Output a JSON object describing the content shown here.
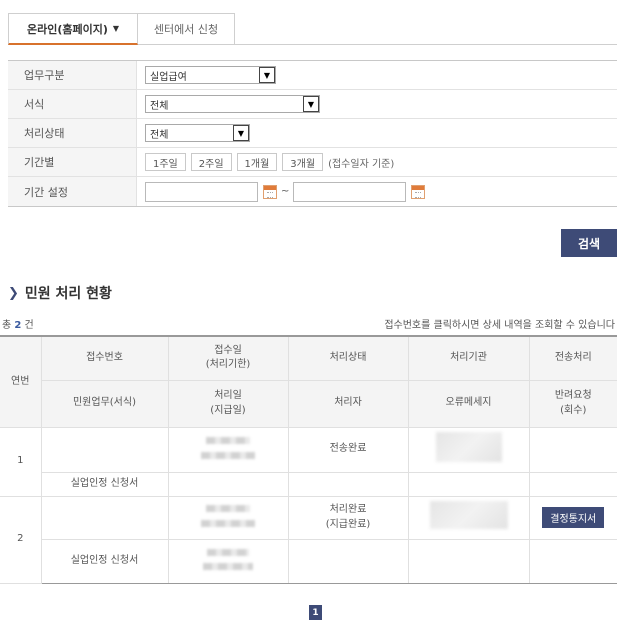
{
  "tabs": {
    "online_label": "온라인(홈페이지)",
    "center_label": "센터에서 신청"
  },
  "filters": {
    "work_type": {
      "label": "업무구분",
      "value": "실업급여"
    },
    "form": {
      "label": "서식",
      "value": "전체"
    },
    "status": {
      "label": "처리상태",
      "value": "전체"
    },
    "period": {
      "label": "기간별",
      "buttons": [
        "1주일",
        "2주일",
        "1개월",
        "3개월"
      ],
      "note": "(접수일자 기준)"
    },
    "date_range": {
      "label": "기간 설정",
      "separator": "~"
    }
  },
  "search_button": "검색",
  "section_title": "민원 처리 현황",
  "summary": {
    "count_prefix": "총",
    "count": "2",
    "count_suffix": "건",
    "hint": "접수번호를 클릭하시면 상세 내역을 조회할 수 있습니다"
  },
  "table": {
    "col_index": "연번",
    "h1": [
      "접수번호",
      "접수일\n(처리기한)",
      "처리상태",
      "처리기관",
      "전송처리"
    ],
    "h2": [
      "민원업무(서식)",
      "처리일\n(지급일)",
      "처리자",
      "오류메세지",
      "반려요청\n(회수)"
    ],
    "rows": [
      {
        "index": "1",
        "status": "전송완료",
        "form": "실업인정 신청서"
      },
      {
        "index": "2",
        "status": "처리완료\n(지급완료)",
        "action": "결정통지서",
        "form": "실업인정 신청서"
      }
    ]
  },
  "pager": {
    "current": "1"
  }
}
